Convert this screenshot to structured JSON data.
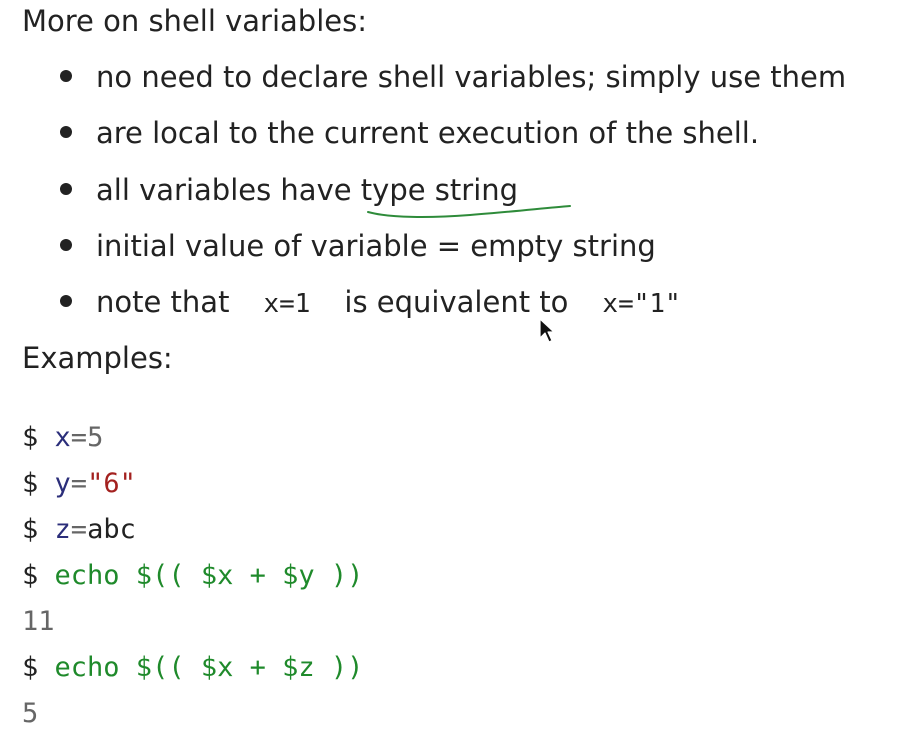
{
  "slide": {
    "heading": "More on shell variables:",
    "bullets": [
      {
        "text": "no need to declare shell variables; simply use them"
      },
      {
        "text": "are local to the current execution of the shell."
      },
      {
        "pre": "all variables have ",
        "highlight": "type string"
      },
      {
        "text": "initial value of variable = empty string"
      },
      {
        "pre": "note that",
        "code1": "x=1",
        "mid": "is equivalent to",
        "code2": "x=\"1\""
      }
    ],
    "examples_heading": "Examples:"
  },
  "code": {
    "prompt": "$",
    "line1": {
      "var": "x",
      "op": "=",
      "val": "5"
    },
    "line2": {
      "var": "y",
      "op": "=",
      "val": "\"6\""
    },
    "line3": {
      "var": "z",
      "op": "=",
      "val": "abc"
    },
    "line4": {
      "cmd": "echo $(( $x + $y ))"
    },
    "output1": "11",
    "line6": {
      "cmd": "echo $(( $x + $z ))"
    },
    "output2": "5"
  },
  "colors": {
    "text": "#222222",
    "variable": "#2b2e7a",
    "string": "#a3211f",
    "command": "#1f8a2b",
    "output": "#666666",
    "annotation": "#2e8b3a"
  },
  "icons": {
    "pointer": "mouse-cursor-icon",
    "annotation": "handwritten-underline"
  }
}
